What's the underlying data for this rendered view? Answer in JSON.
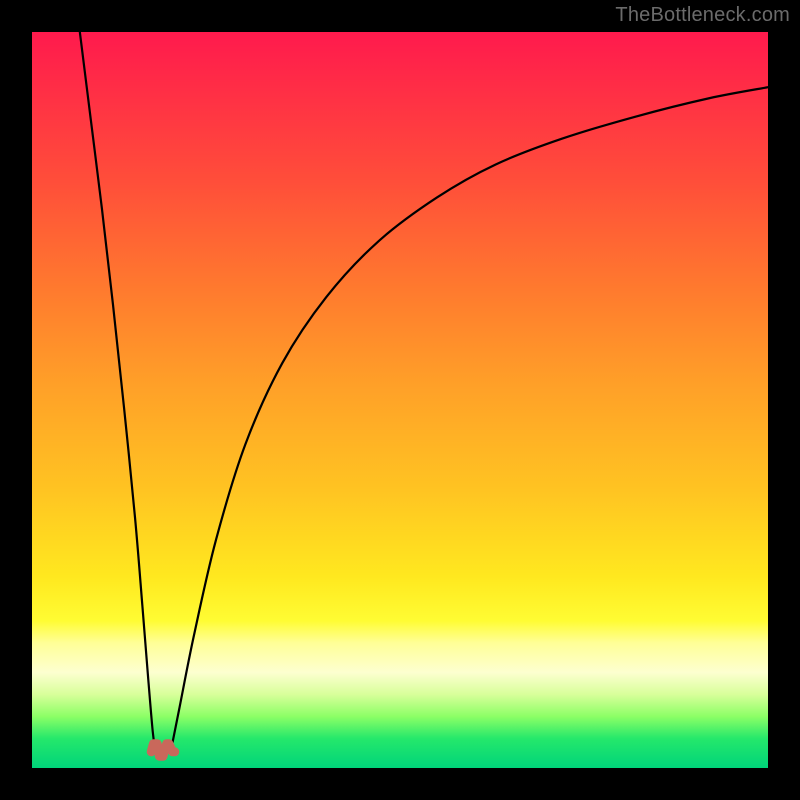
{
  "watermark": "TheBottleneck.com",
  "chart_data": {
    "type": "line",
    "title": "",
    "xlabel": "",
    "ylabel": "",
    "xlim": [
      0,
      100
    ],
    "ylim": [
      0,
      100
    ],
    "grid": false,
    "legend": false,
    "annotations": [],
    "series": [
      {
        "name": "left-branch",
        "x": [
          6.5,
          8.0,
          9.5,
          11.0,
          12.5,
          14.0,
          15.0,
          15.8,
          16.4,
          16.8
        ],
        "y": [
          100,
          88,
          76,
          63,
          49,
          34,
          22,
          12,
          5,
          2
        ]
      },
      {
        "name": "dip-marker",
        "x": [
          16.2,
          16.5,
          17.0,
          17.3,
          17.8,
          18.3,
          18.6,
          19.1,
          19.4
        ],
        "y": [
          2.2,
          3.3,
          3.3,
          1.6,
          1.6,
          3.3,
          3.3,
          2.2,
          2.2
        ]
      },
      {
        "name": "right-branch",
        "x": [
          18.8,
          20.0,
          22.0,
          25.0,
          29.0,
          34.0,
          40.0,
          47.0,
          55.0,
          63.0,
          72.0,
          82.0,
          92.0,
          100.0
        ],
        "y": [
          2,
          8,
          18,
          31,
          44,
          55,
          64,
          71.5,
          77.5,
          82,
          85.5,
          88.5,
          91,
          92.5
        ]
      }
    ],
    "colors": {
      "curve": "#000000",
      "dip_marker": "#c9685b",
      "gradient_top": "#ff1a4d",
      "gradient_mid": "#ffe81f",
      "gradient_bottom": "#00d47a"
    }
  }
}
